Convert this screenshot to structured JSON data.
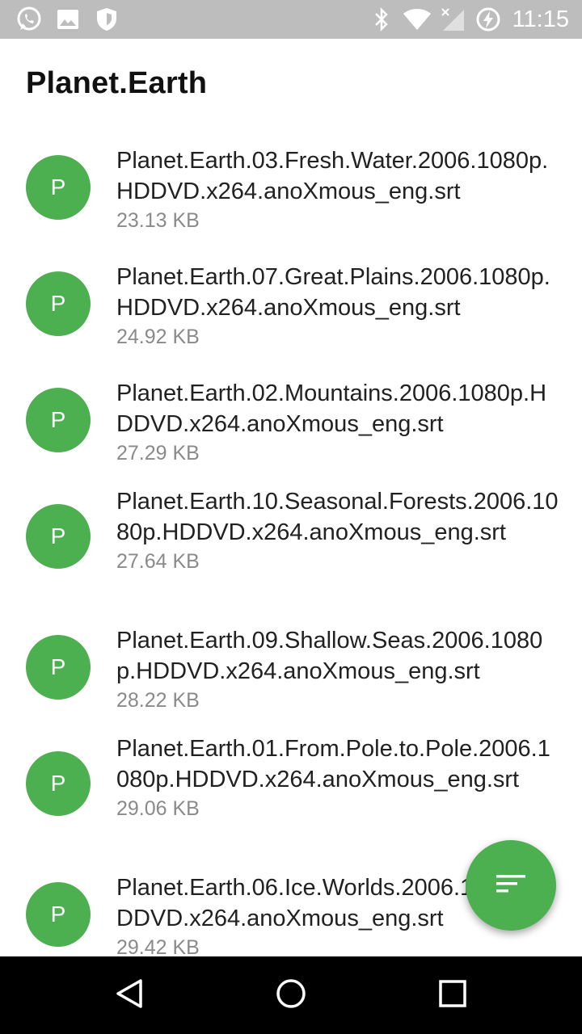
{
  "status_bar": {
    "left_icons": [
      "whatsapp-icon",
      "image-icon",
      "shield-icon"
    ],
    "right_icons": [
      "bluetooth-icon",
      "wifi-icon",
      "signal-icon",
      "battery-charging-icon"
    ],
    "time": "11:15"
  },
  "app_bar": {
    "title": "Planet.Earth"
  },
  "files": [
    {
      "avatar": "P",
      "name": "Planet.Earth.03.Fresh.Water.2006.1080p.HDDVD.x264.anoXmous_eng.srt",
      "size": "23.13 KB"
    },
    {
      "avatar": "P",
      "name": "Planet.Earth.07.Great.Plains.2006.1080p.HDDVD.x264.anoXmous_eng.srt",
      "size": "24.92 KB"
    },
    {
      "avatar": "P",
      "name": "Planet.Earth.02.Mountains.2006.1080p.HDDVD.x264.anoXmous_eng.srt",
      "size": "27.29 KB"
    },
    {
      "avatar": "P",
      "name": "Planet.Earth.10.Seasonal.Forests.2006.1080p.HDDVD.x264.anoXmous_eng.srt",
      "size": "27.64 KB"
    },
    {
      "avatar": "P",
      "name": "Planet.Earth.09.Shallow.Seas.2006.1080p.HDDVD.x264.anoXmous_eng.srt",
      "size": "28.22 KB"
    },
    {
      "avatar": "P",
      "name": "Planet.Earth.01.From.Pole.to.Pole.2006.1080p.HDDVD.x264.anoXmous_eng.srt",
      "size": "29.06 KB"
    },
    {
      "avatar": "P",
      "name": "Planet.Earth.06.Ice.Worlds.2006.1080p.HDDVD.x264.anoXmous_eng.srt",
      "size": "29.42 KB"
    }
  ],
  "fab": {
    "icon": "sort-icon"
  },
  "nav_bar": {
    "icons": [
      "back-icon",
      "home-icon",
      "recents-icon"
    ]
  },
  "colors": {
    "accent": "#4caf50",
    "status_bar": "#bdbdbd",
    "nav_bar": "#000000"
  }
}
